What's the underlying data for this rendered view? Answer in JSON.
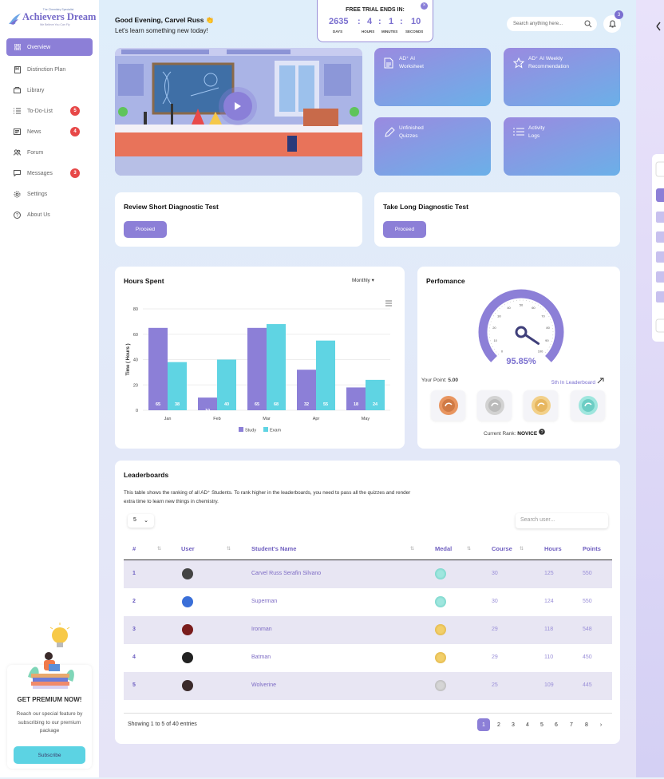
{
  "logo": {
    "tagline": "The Chemistry Specialist",
    "name": "Achievers Dream",
    "sub": "We Believe You Can Fly"
  },
  "nav": [
    {
      "label": "Overview",
      "icon": "grid-icon",
      "active": true
    },
    {
      "label": "Distinction Plan",
      "icon": "bookmark-icon"
    },
    {
      "label": "Library",
      "icon": "folder-icon"
    },
    {
      "label": "To-Do-List",
      "icon": "list-icon",
      "badge": "5"
    },
    {
      "label": "News",
      "icon": "newspaper-icon",
      "badge": "4"
    },
    {
      "label": "Forum",
      "icon": "people-icon"
    },
    {
      "label": "Messages",
      "icon": "chat-icon",
      "badge": "3"
    },
    {
      "label": "Settings",
      "icon": "gear-icon"
    },
    {
      "label": "About Us",
      "icon": "help-icon"
    }
  ],
  "promo": {
    "title": "GET PREMIUM NOW!",
    "text": "Reach our special feature by subscribing to our premium package",
    "button": "Subscribe"
  },
  "header": {
    "greeting": "Good Evening, Carvel Russ 👏",
    "subtitle": "Let's learn something new today!",
    "search_placeholder": "Search anything here...",
    "notifications": "3"
  },
  "trial": {
    "title": "FREE TRIAL ENDS IN:",
    "days": "2635",
    "hours": "4",
    "minutes": "1",
    "seconds": "10",
    "days_label": "DAYS",
    "hours_label": "HOURS",
    "minutes_label": "MINUTES",
    "seconds_label": "SECONDS",
    "sep": ":"
  },
  "tiles": [
    {
      "label": "AD⁺ AI\nWorksheet",
      "icon": "worksheet-icon"
    },
    {
      "label": "AD⁺ AI Weekly\nRecommendation",
      "icon": "star-icon"
    },
    {
      "label": "Unfinished\nQuizzes",
      "icon": "pencil-icon"
    },
    {
      "label": "Activity\nLogs",
      "icon": "list-icon"
    }
  ],
  "diagnostic": [
    {
      "title": "Review Short Diagnostic Test",
      "button": "Proceed"
    },
    {
      "title": "Take Long Diagnostic Test",
      "button": "Proceed"
    }
  ],
  "hours": {
    "title": "Hours Spent",
    "period": "Monthly"
  },
  "chart_data": {
    "type": "bar",
    "categories": [
      "Jan",
      "Feb",
      "Mar",
      "Apr",
      "May"
    ],
    "series": [
      {
        "name": "Study",
        "values": [
          65,
          10,
          65,
          32,
          18
        ],
        "color": "#8c7fd7"
      },
      {
        "name": "Exam",
        "values": [
          38,
          40,
          68,
          55,
          24
        ],
        "color": "#5fd4e3"
      }
    ],
    "ylabel": "Time ( Hours )",
    "yticks": [
      0,
      20,
      40,
      60,
      80
    ],
    "ylim": [
      0,
      80
    ],
    "legend": "bottom"
  },
  "performance": {
    "title": "Perfomance",
    "value": 95.85,
    "value_label": "95.85%",
    "dial_ticks": [
      "0",
      "10",
      "20",
      "30",
      "40",
      "50",
      "60",
      "70",
      "80",
      "90",
      "100"
    ],
    "points_label": "Your Point:",
    "points": "5.00",
    "leaderboard": "5th In Leaderboard",
    "rank_label": "Current Rank:",
    "rank": "NOVICE",
    "medals": [
      "bronze-medal-icon",
      "silver-medal-icon",
      "gold-medal-icon",
      "platinum-medal-icon"
    ]
  },
  "leaderboard": {
    "title": "Leaderboards",
    "description": "This table shows the ranking of all AD⁺ Students. To rank higher in the leaderboards, you need to pass all the quizzes and render extra time to learn new things in chemistry.",
    "page_size": "5",
    "search_placeholder": "Search user...",
    "columns": [
      "#",
      "User",
      "Student's Name",
      "Medal",
      "Course",
      "Hours",
      "Points"
    ],
    "rows": [
      {
        "rank": "1",
        "avatar": "avatar-1",
        "name": "Carvel Russ Serafin Silvano",
        "medal": "platinum",
        "course": "30",
        "hours": "125",
        "points": "550"
      },
      {
        "rank": "2",
        "avatar": "avatar-superman",
        "name": "Superman",
        "medal": "platinum",
        "course": "30",
        "hours": "124",
        "points": "550"
      },
      {
        "rank": "3",
        "avatar": "avatar-ironman",
        "name": "Ironman",
        "medal": "gold",
        "course": "29",
        "hours": "118",
        "points": "548"
      },
      {
        "rank": "4",
        "avatar": "avatar-batman",
        "name": "Batman",
        "medal": "gold",
        "course": "29",
        "hours": "110",
        "points": "450"
      },
      {
        "rank": "5",
        "avatar": "avatar-wolverine",
        "name": "Wolverine",
        "medal": "silver",
        "course": "25",
        "hours": "109",
        "points": "445"
      }
    ],
    "showing": "Showing 1 to 5 of 40 entries",
    "pages": [
      "1",
      "2",
      "3",
      "4",
      "5",
      "6",
      "7",
      "8",
      "›"
    ],
    "current_page": "1"
  },
  "colors": {
    "accent": "#8c7fd7",
    "cyan": "#5fd4e3",
    "badge": "#e74848"
  }
}
